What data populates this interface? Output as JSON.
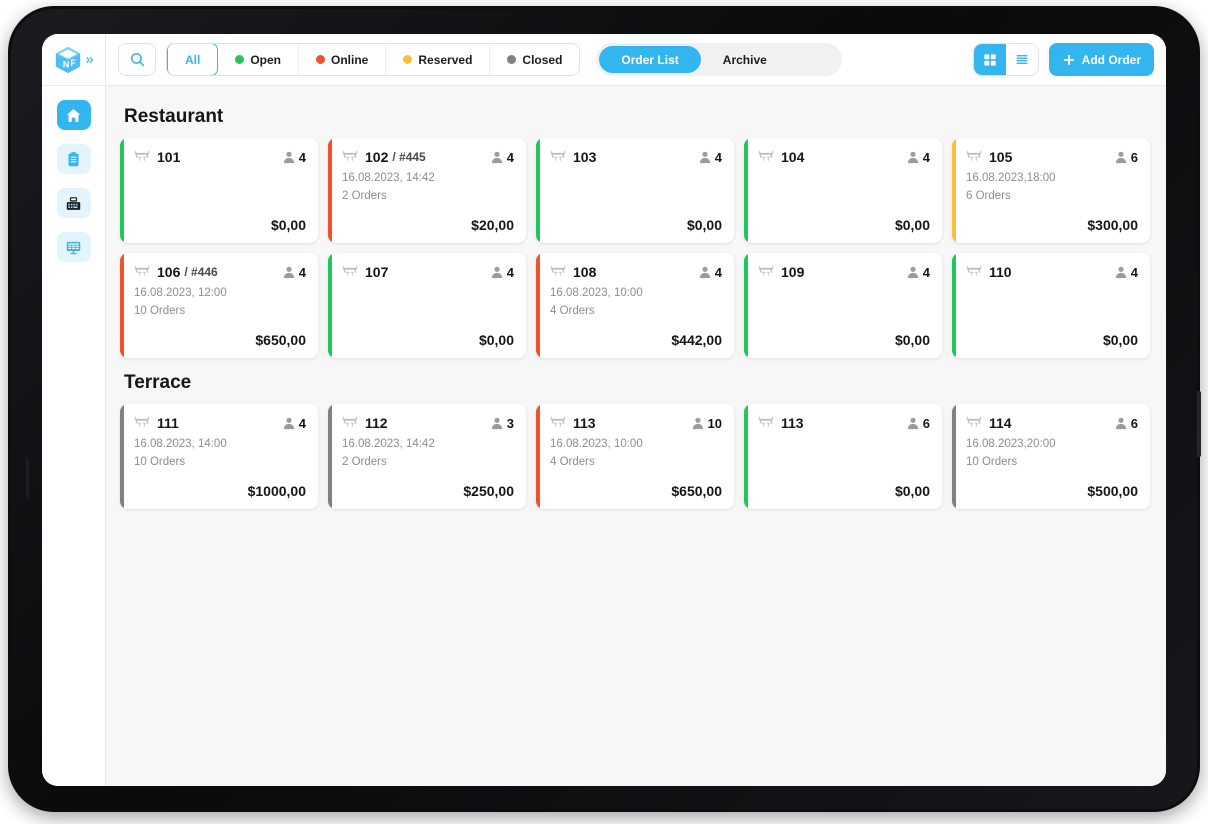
{
  "app": {
    "logo_letters": [
      "N",
      "F"
    ],
    "expand_icon": "chevron-double-right-icon"
  },
  "sidebar": {
    "items": [
      {
        "name": "home",
        "icon": "home-icon",
        "active": true
      },
      {
        "name": "orders",
        "icon": "clipboard-icon",
        "active": false
      },
      {
        "name": "register",
        "icon": "cash-register-icon",
        "active": false
      },
      {
        "name": "tables",
        "icon": "table-layout-icon",
        "active": false
      }
    ]
  },
  "toolbar": {
    "search_icon": "search-icon",
    "filters": [
      {
        "label": "All",
        "color": "",
        "selected": true
      },
      {
        "label": "Open",
        "color": "#22c55e",
        "selected": false
      },
      {
        "label": "Online",
        "color": "#f0522d",
        "selected": false
      },
      {
        "label": "Reserved",
        "color": "#fbbf3c",
        "selected": false
      },
      {
        "label": "Closed",
        "color": "#808086",
        "selected": false
      }
    ],
    "segments": [
      {
        "label": "Order List",
        "selected": true
      },
      {
        "label": "Archive",
        "selected": false
      }
    ],
    "views": [
      {
        "name": "grid-view",
        "icon": "grid-icon",
        "selected": true
      },
      {
        "name": "list-view",
        "icon": "list-icon",
        "selected": false
      }
    ],
    "add_order_label": "Add Order",
    "add_order_icon": "plus-icon",
    "accent_color": "#33b5ef"
  },
  "status_colors": {
    "open": "#22c55e",
    "online": "#f0522d",
    "reserved": "#fbbf3c",
    "closed": "#808086"
  },
  "sections": [
    {
      "title": "Restaurant",
      "cards": [
        {
          "table": "101",
          "order": "",
          "guests": "4",
          "datetime": "",
          "orders": "",
          "amount": "$0,00",
          "status": "open"
        },
        {
          "table": "102",
          "order": "/ #445",
          "guests": "4",
          "datetime": "16.08.2023, 14:42",
          "orders": "2 Orders",
          "amount": "$20,00",
          "status": "online"
        },
        {
          "table": "103",
          "order": "",
          "guests": "4",
          "datetime": "",
          "orders": "",
          "amount": "$0,00",
          "status": "open"
        },
        {
          "table": "104",
          "order": "",
          "guests": "4",
          "datetime": "",
          "orders": "",
          "amount": "$0,00",
          "status": "open"
        },
        {
          "table": "105",
          "order": "",
          "guests": "6",
          "datetime": "16.08.2023,18:00",
          "orders": "6 Orders",
          "amount": "$300,00",
          "status": "reserved"
        },
        {
          "table": "106",
          "order": "/ #446",
          "guests": "4",
          "datetime": "16.08.2023, 12:00",
          "orders": "10 Orders",
          "amount": "$650,00",
          "status": "online"
        },
        {
          "table": "107",
          "order": "",
          "guests": "4",
          "datetime": "",
          "orders": "",
          "amount": "$0,00",
          "status": "open"
        },
        {
          "table": "108",
          "order": "",
          "guests": "4",
          "datetime": "16.08.2023, 10:00",
          "orders": "4 Orders",
          "amount": "$442,00",
          "status": "online"
        },
        {
          "table": "109",
          "order": "",
          "guests": "4",
          "datetime": "",
          "orders": "",
          "amount": "$0,00",
          "status": "open"
        },
        {
          "table": "110",
          "order": "",
          "guests": "4",
          "datetime": "",
          "orders": "",
          "amount": "$0,00",
          "status": "open"
        }
      ]
    },
    {
      "title": "Terrace",
      "cards": [
        {
          "table": "111",
          "order": "",
          "guests": "4",
          "datetime": "16.08.2023, 14:00",
          "orders": "10 Orders",
          "amount": "$1000,00",
          "status": "closed"
        },
        {
          "table": "112",
          "order": "",
          "guests": "3",
          "datetime": "16.08.2023, 14:42",
          "orders": "2 Orders",
          "amount": "$250,00",
          "status": "closed"
        },
        {
          "table": "113",
          "order": "",
          "guests": "10",
          "datetime": "16.08.2023, 10:00",
          "orders": "4 Orders",
          "amount": "$650,00",
          "status": "online"
        },
        {
          "table": "113",
          "order": "",
          "guests": "6",
          "datetime": "",
          "orders": "",
          "amount": "$0,00",
          "status": "open"
        },
        {
          "table": "114",
          "order": "",
          "guests": "6",
          "datetime": "16.08.2023,20:00",
          "orders": "10 Orders",
          "amount": "$500,00",
          "status": "closed"
        }
      ]
    }
  ]
}
